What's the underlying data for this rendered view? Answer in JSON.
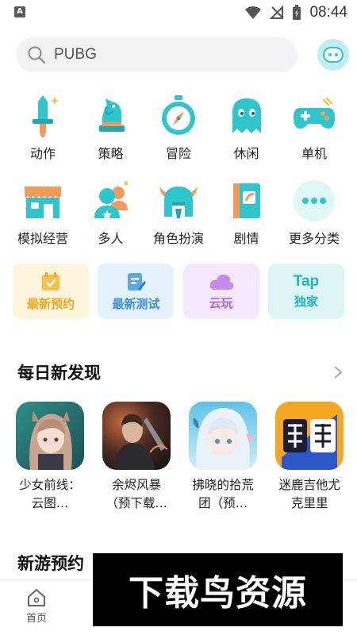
{
  "status_bar": {
    "app_badge": "A",
    "time": "08:44"
  },
  "search": {
    "value": "PUBG",
    "placeholder": "PUBG"
  },
  "categories": [
    {
      "label": "动作",
      "icon": "sword-icon"
    },
    {
      "label": "策略",
      "icon": "chess-knight-icon"
    },
    {
      "label": "冒险",
      "icon": "compass-icon"
    },
    {
      "label": "休闲",
      "icon": "ghost-icon"
    },
    {
      "label": "单机",
      "icon": "gamepad-icon"
    },
    {
      "label": "模拟经营",
      "icon": "shop-icon"
    },
    {
      "label": "多人",
      "icon": "people-icon"
    },
    {
      "label": "角色扮演",
      "icon": "viking-helmet-icon"
    },
    {
      "label": "剧情",
      "icon": "book-icon"
    },
    {
      "label": "更多分类",
      "icon": "more-dots-icon"
    }
  ],
  "quick_links": [
    {
      "label": "最新预约",
      "icon": "calendar-check-icon",
      "color": "#f3a620"
    },
    {
      "label": "最新测试",
      "icon": "edit-note-icon",
      "color": "#3f8fd8"
    },
    {
      "label": "云玩",
      "icon": "cloud-icon",
      "color": "#b162de"
    },
    {
      "label": "独家",
      "logo": "Tap",
      "color": "#20b5bd"
    }
  ],
  "daily": {
    "title": "每日新发现",
    "games": [
      {
        "name": "少女前线：云图…"
      },
      {
        "name": "余烬风暴（预下载…"
      },
      {
        "name": "拂晓的拾荒团（预…"
      },
      {
        "name": "迷鹿吉他尤克里里"
      }
    ]
  },
  "upcoming": {
    "title": "新游预约"
  },
  "bottom_nav": {
    "home_label": "首页"
  },
  "watermark": {
    "text": "下载鸟资源"
  },
  "colors": {
    "accent": "#2ec5cd",
    "orange": "#f39a5a"
  }
}
